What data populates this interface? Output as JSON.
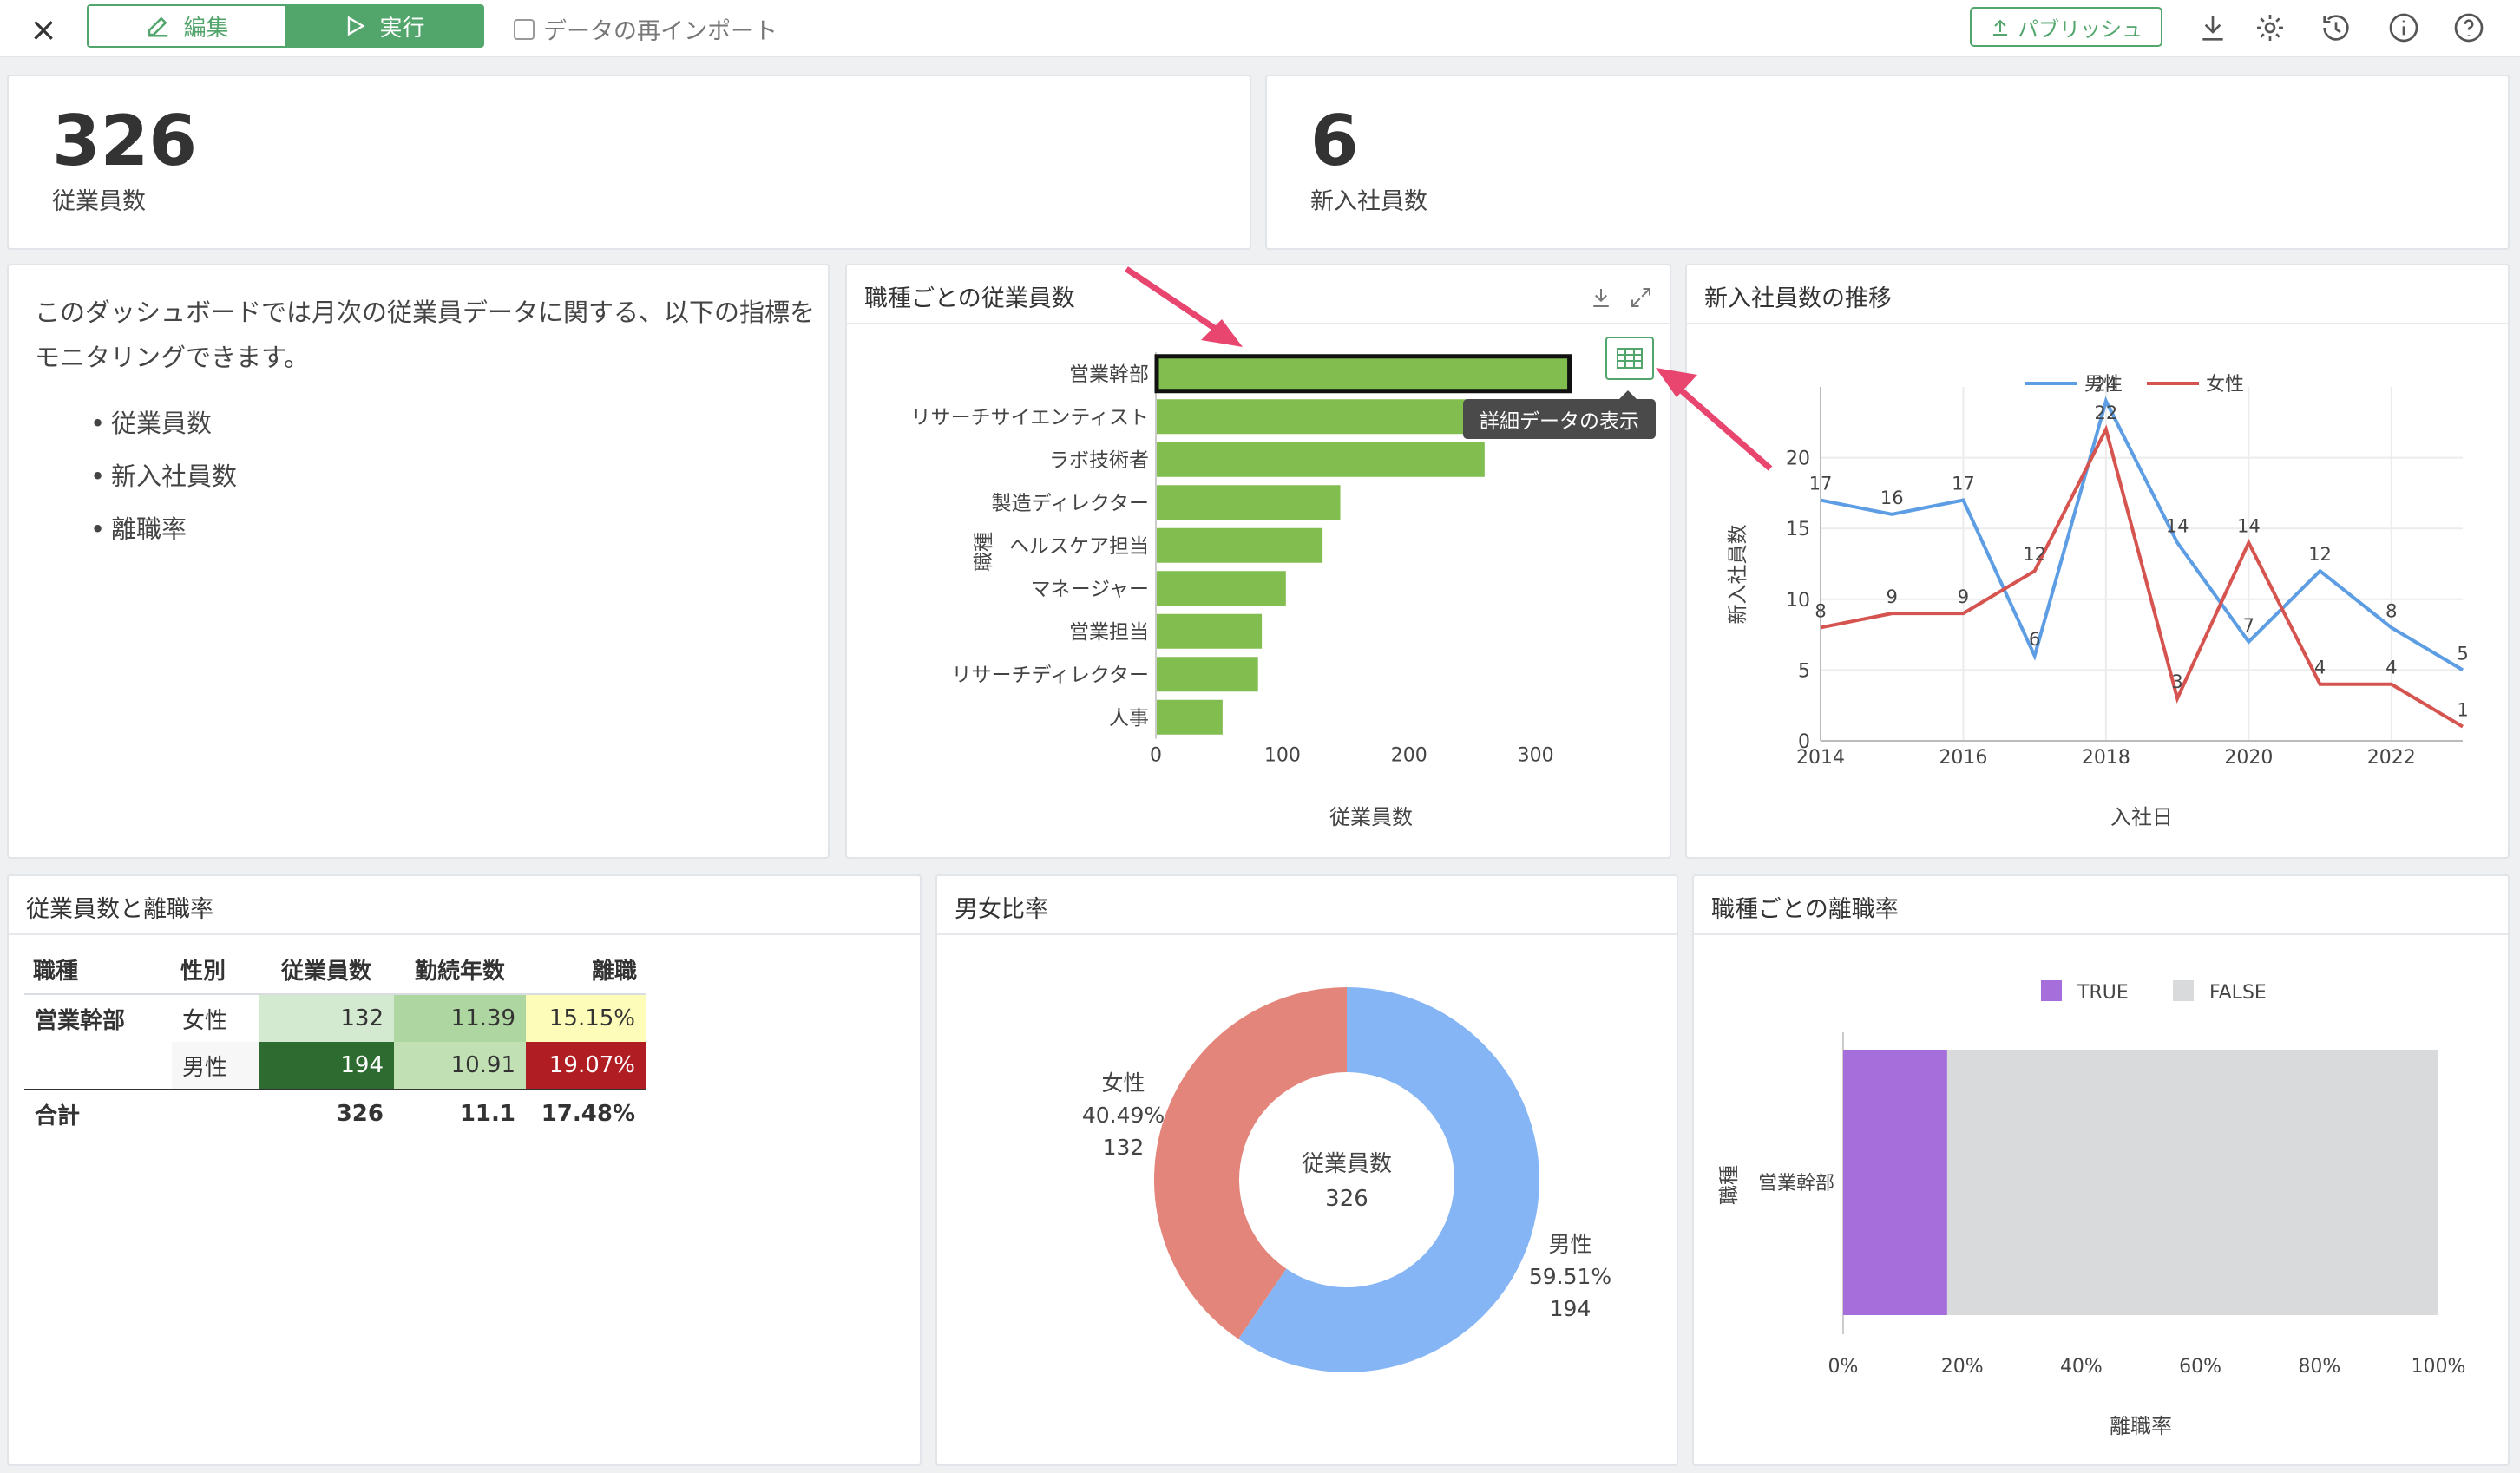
{
  "toolbar": {
    "edit_label": "編集",
    "run_label": "実行",
    "reimport_label": "データの再インポート",
    "publish_label": "パブリッシュ"
  },
  "kpi": [
    {
      "value": "326",
      "label": "従業員数"
    },
    {
      "value": "6",
      "label": "新入社員数"
    }
  ],
  "description": {
    "text": "このダッシュボードでは月次の従業員データに関する、以下の指標をモニタリングできます。",
    "bullets": [
      "従業員数",
      "新入社員数",
      "離職率"
    ]
  },
  "tooltip": "詳細データの表示",
  "cards": {
    "bar_title": "職種ごとの従業員数",
    "line_title": "新入社員数の推移",
    "table_title": "従業員数と離職率",
    "pie_title": "男女比率",
    "stack_title": "職種ごとの離職率"
  },
  "table": {
    "headers": [
      "職種",
      "性別",
      "従業員数",
      "勤続年数",
      "離職"
    ],
    "group": "営業幹部",
    "rows": [
      {
        "gender": "女性",
        "count": "132",
        "years": "11.39",
        "attrition": "15.15%"
      },
      {
        "gender": "男性",
        "count": "194",
        "years": "10.91",
        "attrition": "19.07%"
      }
    ],
    "total": {
      "label": "合計",
      "count": "326",
      "years": "11.1",
      "attrition": "17.48%"
    },
    "colors": {
      "count_female": "#d4ead0",
      "count_male": "#2e6b30",
      "years_female": "#aed6a0",
      "years_male": "#c1e0b4",
      "attrition_female": "#fdfcb8",
      "attrition_male": "#b01e24"
    }
  },
  "chart_data": [
    {
      "type": "bar",
      "orientation": "horizontal",
      "categories": [
        "営業幹部",
        "リサーチサイエンティスト",
        "ラボ技術者",
        "製造ディレクター",
        "ヘルスケア担当",
        "マネージャー",
        "営業担当",
        "リサーチディレクター",
        "人事"
      ],
      "values": [
        326,
        290,
        259,
        145,
        131,
        102,
        83,
        80,
        52
      ],
      "xlabel": "従業員数",
      "ylabel": "職種",
      "xlim": [
        0,
        340
      ],
      "xticks": [
        0,
        100,
        200,
        300
      ],
      "color": "#82bd50",
      "highlighted": "営業幹部"
    },
    {
      "type": "line",
      "x": [
        2014,
        2015,
        2016,
        2017,
        2018,
        2019,
        2020,
        2021,
        2022,
        2023
      ],
      "series": [
        {
          "name": "男性",
          "values": [
            17,
            16,
            17,
            6,
            24,
            14,
            7,
            12,
            8,
            5
          ],
          "color": "#5d9de3"
        },
        {
          "name": "女性",
          "values": [
            8,
            9,
            9,
            12,
            22,
            3,
            14,
            4,
            4,
            1
          ],
          "color": "#d65450"
        }
      ],
      "xlabel": "入社日",
      "ylabel": "新入社員数",
      "ylim": [
        0,
        25
      ],
      "yticks": [
        0,
        5,
        10,
        15,
        20
      ],
      "xticks": [
        2014,
        2016,
        2018,
        2020,
        2022
      ],
      "legend": "top"
    },
    {
      "type": "pie",
      "donut": true,
      "center_label": "従業員数",
      "center_value": "326",
      "slices": [
        {
          "name": "男性",
          "value": 194,
          "percent": "59.51%",
          "color": "#86b5f5"
        },
        {
          "name": "女性",
          "value": 132,
          "percent": "40.49%",
          "color": "#e3857a"
        }
      ]
    },
    {
      "type": "bar",
      "orientation": "horizontal",
      "stacked": "percent",
      "categories": [
        "営業幹部"
      ],
      "series": [
        {
          "name": "TRUE",
          "values": [
            17.48
          ],
          "color": "#a66edb"
        },
        {
          "name": "FALSE",
          "values": [
            82.52
          ],
          "color": "#d9dadc"
        }
      ],
      "xlabel": "離職率",
      "ylabel": "職種",
      "xticks": [
        "0%",
        "20%",
        "40%",
        "60%",
        "80%",
        "100%"
      ],
      "legend": "top"
    }
  ]
}
